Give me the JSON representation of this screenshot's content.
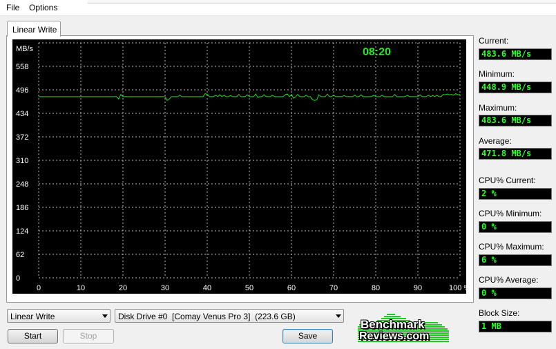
{
  "menu": {
    "file": "File",
    "options": "Options"
  },
  "tab": {
    "label": "Linear Write"
  },
  "graph": {
    "unit": "MB/s",
    "elapsed": "08:20",
    "y_ticks": [
      "558",
      "496",
      "434",
      "372",
      "310",
      "248",
      "186",
      "124",
      "62",
      "0"
    ],
    "x_ticks": [
      "0",
      "10",
      "20",
      "30",
      "40",
      "50",
      "60",
      "70",
      "80",
      "90",
      "100 %"
    ],
    "grid": true,
    "colors": {
      "background": "#000000",
      "grid": "#bdbdbd",
      "line": "#1ed81e",
      "text": "#ffffff",
      "elapsed": "#22e822"
    }
  },
  "chart_data": {
    "type": "line",
    "xlim": [
      0,
      100
    ],
    "ylim": [
      0,
      620
    ],
    "x_step": 0.5,
    "base": 478,
    "spikes": [
      [
        19.0,
        -6
      ],
      [
        19.5,
        6
      ],
      [
        30.5,
        -10
      ],
      [
        31.0,
        -6
      ],
      [
        33.5,
        4
      ],
      [
        39.5,
        8
      ],
      [
        40.0,
        6
      ],
      [
        42.0,
        4
      ],
      [
        43.0,
        5
      ],
      [
        44.0,
        4
      ],
      [
        45.5,
        3
      ],
      [
        47.5,
        6
      ],
      [
        49.5,
        5
      ],
      [
        51.5,
        7
      ],
      [
        52.0,
        -2
      ],
      [
        53.5,
        5
      ],
      [
        55.5,
        4
      ],
      [
        58.5,
        5
      ],
      [
        59.0,
        7
      ],
      [
        60.0,
        6
      ],
      [
        60.5,
        -4
      ],
      [
        61.5,
        6
      ],
      [
        63.5,
        4
      ],
      [
        65.0,
        -8
      ],
      [
        65.5,
        -10
      ],
      [
        66.0,
        -8
      ],
      [
        66.5,
        5
      ],
      [
        68.5,
        7
      ],
      [
        70.0,
        4
      ],
      [
        72.5,
        3
      ],
      [
        75.0,
        4
      ],
      [
        76.5,
        5
      ],
      [
        79.5,
        4
      ],
      [
        81.5,
        4
      ],
      [
        84.5,
        6
      ],
      [
        87.5,
        4
      ],
      [
        90.5,
        5
      ],
      [
        92.5,
        4
      ],
      [
        93.5,
        3
      ],
      [
        94.5,
        4
      ],
      [
        96.0,
        6
      ],
      [
        96.5,
        5
      ],
      [
        97.0,
        7
      ],
      [
        97.5,
        5
      ],
      [
        98.0,
        6
      ],
      [
        98.5,
        4
      ],
      [
        99.0,
        8
      ],
      [
        99.5,
        5
      ],
      [
        100.0,
        6
      ]
    ]
  },
  "stats": [
    {
      "label": "Current:",
      "value": "483.6 MB/s"
    },
    {
      "label": "Minimum:",
      "value": "448.9 MB/s"
    },
    {
      "label": "Maximum:",
      "value": "483.6 MB/s"
    },
    {
      "label": "Average:",
      "value": "471.8 MB/s"
    },
    {
      "label": "CPU% Current:",
      "value": "2 %"
    },
    {
      "label": "CPU% Minimum:",
      "value": "0 %"
    },
    {
      "label": "CPU% Maximum:",
      "value": "6 %"
    },
    {
      "label": "CPU% Average:",
      "value": "0 %"
    },
    {
      "label": "Block Size:",
      "value": "1 MB"
    }
  ],
  "controls": {
    "test_select": "Linear Write",
    "drive_select": "Disk Drive #0  [Comay Venus Pro 3]  (223.6 GB)",
    "start": "Start",
    "stop": "Stop",
    "save": "Save"
  },
  "logo": {
    "line1": "Benchmark",
    "line2": "Reviews.com"
  }
}
